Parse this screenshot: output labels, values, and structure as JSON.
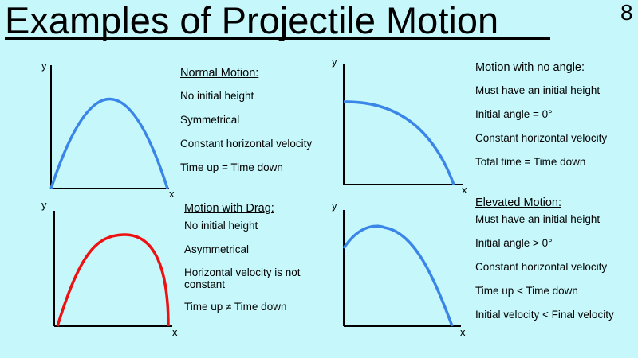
{
  "title": "Examples of Projectile Motion",
  "slide_number": "8",
  "axis_labels": {
    "y": "y",
    "x": "x"
  },
  "colors": {
    "blue_curve": "#3a86e8",
    "red_curve": "#ee1111",
    "background": "#c6f8fb"
  },
  "panels": {
    "normal": {
      "heading": "Normal Motion:",
      "lines": [
        "No initial height",
        "Symmetrical",
        "Constant horizontal velocity",
        "Time up = Time down"
      ]
    },
    "no_angle": {
      "heading": "Motion with no angle:",
      "lines": [
        "Must have an initial height",
        "Initial angle = 0°",
        "Constant horizontal velocity",
        "Total time = Time down"
      ]
    },
    "drag": {
      "heading": "Motion with Drag:",
      "lines": [
        "No initial height",
        "Asymmetrical",
        "Horizontal velocity is not constant",
        "Time up ≠ Time down"
      ]
    },
    "elevated": {
      "heading": "Elevated Motion:",
      "lines": [
        "Must have an initial height",
        "Initial angle > 0°",
        "Constant horizontal velocity",
        "Time up < Time down",
        "Initial velocity < Final velocity"
      ]
    }
  }
}
